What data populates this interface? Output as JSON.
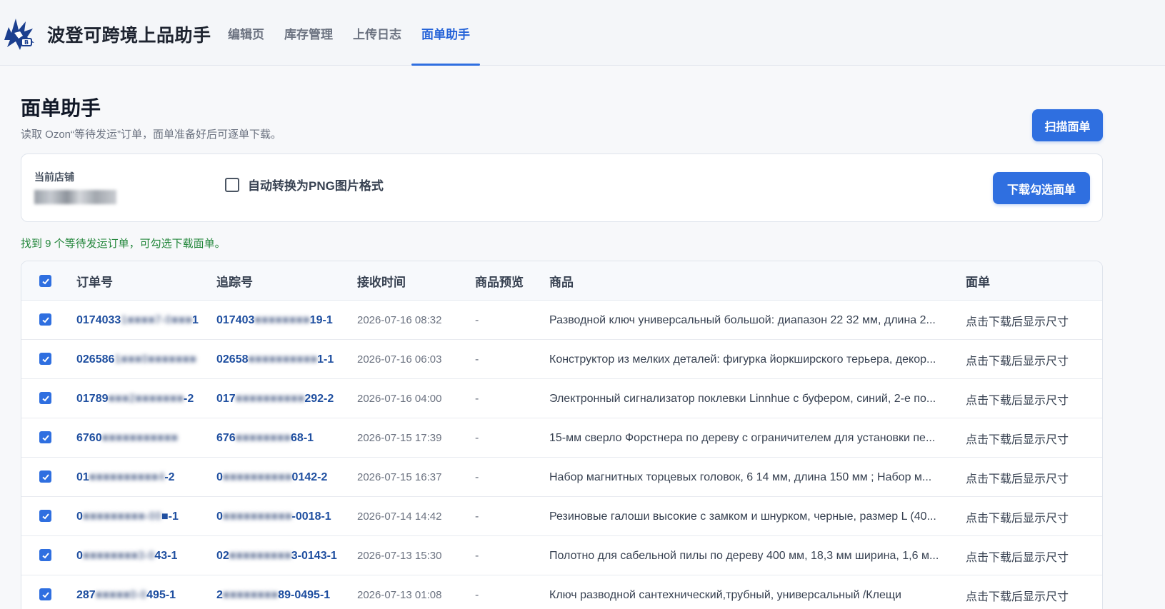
{
  "brand": {
    "name": "波登可跨境上品助手"
  },
  "nav": {
    "items": [
      {
        "label": "编辑页",
        "active": false
      },
      {
        "label": "库存管理",
        "active": false
      },
      {
        "label": "上传日志",
        "active": false
      },
      {
        "label": "面单助手",
        "active": true
      }
    ]
  },
  "page": {
    "title": "面单助手",
    "subtitle": "读取 Ozon“等待发运”订单，面单准备好后可逐单下载。",
    "scan_button": "扫描面单"
  },
  "store": {
    "label": "当前店铺",
    "value": "████ ███",
    "png_checkbox_label": "自动转换为PNG图片格式",
    "png_checked": false,
    "download_button": "下载勾选面单"
  },
  "status": {
    "found_text": "找到 9 个等待发运订单，可勾选下载面单。"
  },
  "table": {
    "headers": {
      "order": "订单号",
      "track": "追踪号",
      "time": "接收时间",
      "preview": "商品预览",
      "product": "商品",
      "label": "面单"
    },
    "rows": [
      {
        "order_a": "0174033",
        "order_m": "1■■■■7-0■■■",
        "order_b": "1",
        "track_a": "017403",
        "track_m": "■■■■■■■■",
        "track_b": "19-1",
        "time": "2026-07-16 08:32",
        "preview": "-",
        "product": "Разводной ключ универсальный большой: диапазон 22 32 мм, длина 2...",
        "label": "点击下载后显示尺寸"
      },
      {
        "order_a": "026586",
        "order_m": "1■■■0■■■■■■■",
        "order_b": "",
        "track_a": "02658",
        "track_m": "■■■■■■■■■■",
        "track_b": "1-1",
        "time": "2026-07-16 06:03",
        "preview": "-",
        "product": "Конструктор из мелких деталей: фигурка йоркширского терьера, декор...",
        "label": "点击下载后显示尺寸"
      },
      {
        "order_a": "01789",
        "order_m": "■■■2■■■■■■■",
        "order_b": "-2",
        "track_a": "017",
        "track_m": "■■■■■■■■■■",
        "track_b": "292-2",
        "time": "2026-07-16 04:00",
        "preview": "-",
        "product": "Электронный сигнализатор поклевки Linnhue с буфером, синий, 2-е по...",
        "label": "点击下载后显示尺寸"
      },
      {
        "order_a": "6760",
        "order_m": "■■■■■■■■■■■",
        "order_b": "",
        "track_a": "676",
        "track_m": "■■■■■■■■",
        "track_b": "68-1",
        "time": "2026-07-15 17:39",
        "preview": "-",
        "product": "15-мм сверло Форстнера по дереву с ограничителем для установки пе...",
        "label": "点击下载后显示尺寸"
      },
      {
        "order_a": "01",
        "order_m": "■■■■■■■■■■4",
        "order_b": "-2",
        "track_a": "0",
        "track_m": "■■■■■■■■■■",
        "track_b": "0142-2",
        "time": "2026-07-15 16:37",
        "preview": "-",
        "product": "Набор магнитных торцевых головок, 6 14 мм, длина 150 мм ; Набор м...",
        "label": "点击下载后显示尺寸"
      },
      {
        "order_a": "0",
        "order_m": "■■■■■■■■■-00",
        "order_b": "■-1",
        "track_a": "0",
        "track_m": "■■■■■■■■■■",
        "track_b": "-0018-1",
        "time": "2026-07-14 14:42",
        "preview": "-",
        "product": "Резиновые галоши высокие с замком и шнурком, черные, размер L (40...",
        "label": "点击下载后显示尺寸"
      },
      {
        "order_a": "0",
        "order_m": "■■■■■■■■3-0",
        "order_b": "43-1",
        "track_a": "02",
        "track_m": "■■■■■■■■■",
        "track_b": "3-0143-1",
        "time": "2026-07-13 15:30",
        "preview": "-",
        "product": "Полотно для сабельной пилы по дереву 400 мм, 18,3 мм ширина, 1,6 м...",
        "label": "点击下载后显示尺寸"
      },
      {
        "order_a": "287",
        "order_m": "■■■■■0-0",
        "order_b": "495-1",
        "track_a": "2",
        "track_m": "■■■■■■■■",
        "track_b": "89-0495-1",
        "time": "2026-07-13 01:08",
        "preview": "-",
        "product": "Ключ разводной сантехнический,трубный, универсальный /Клещи",
        "label": "点击下载后显示尺寸"
      }
    ]
  },
  "colors": {
    "accent": "#2f6fe0",
    "success": "#22863a",
    "link": "#1f4fa0"
  }
}
